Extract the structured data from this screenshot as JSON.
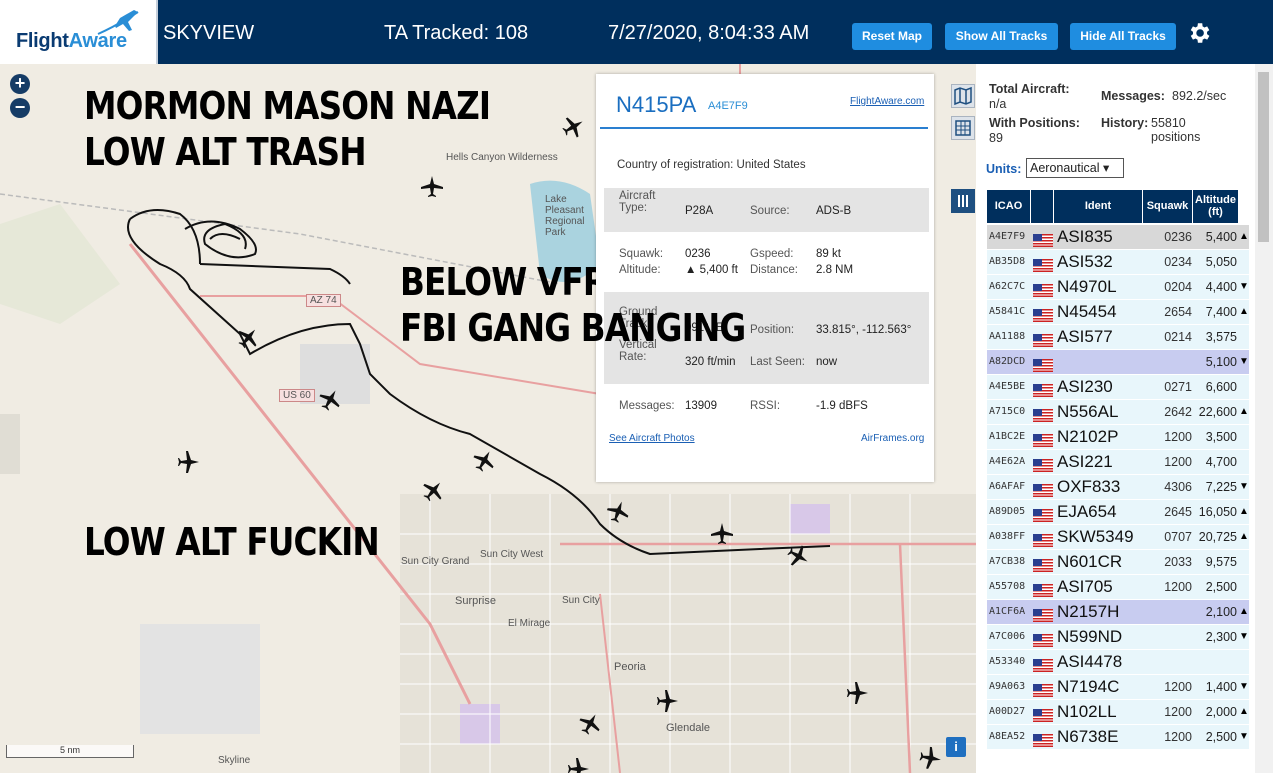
{
  "header": {
    "logo_text_1": "Flight",
    "logo_text_2": "Aware",
    "app_name": "SKYVIEW",
    "tracked": "TA Tracked: 108",
    "datetime": "7/27/2020, 8:04:33 AM",
    "reset_map": "Reset Map",
    "show_tracks": "Show All Tracks",
    "hide_tracks": "Hide All Tracks"
  },
  "overlay_text": {
    "line1": "MORMON MASON NAZI",
    "line2": "LOW ALT TRASH",
    "line3": "BELOW VFR",
    "line4": "FBI GANG BANGING",
    "line5": "LOW ALT FUCKIN"
  },
  "map": {
    "zoom_in": "+",
    "zoom_out": "−",
    "scale": "5 nm",
    "labels": {
      "hells_canyon": "Hells Canyon Wilderness",
      "lake": "Lake Pleasant Regional Park",
      "sun_city_west": "Sun City West",
      "sun_city_grand": "Sun City Grand",
      "surprise": "Surprise",
      "sun_city": "Sun City",
      "el_mirage": "El Mirage",
      "peoria": "Peoria",
      "glendale": "Glendale",
      "skyline": "Skyline",
      "az74": "AZ 74",
      "us60": "US 60"
    },
    "info": "i"
  },
  "popup": {
    "registration": "N415PA",
    "hex": "A4E7F9",
    "flightaware_link": "FlightAware.com",
    "country": "Country of registration: United States",
    "aircraft_type_label": "Aircraft Type:",
    "aircraft_type": "P28A",
    "source_label": "Source:",
    "source": "ADS-B",
    "squawk_label": "Squawk:",
    "squawk": "0236",
    "gspeed_label": "Gspeed:",
    "gspeed": "89 kt",
    "altitude_label": "Altitude:",
    "altitude": "▲ 5,400 ft",
    "distance_label": "Distance:",
    "distance": "2.8 NM",
    "ground_track_label": "Ground Track:",
    "ground_track": "091° (E)",
    "position_label": "Position:",
    "position": "33.815°, -112.563°",
    "vertical_rate_label": "Vertical Rate:",
    "vertical_rate": "320 ft/min",
    "last_seen_label": "Last Seen:",
    "last_seen": "now",
    "messages_label": "Messages:",
    "messages": "13909",
    "rssi_label": "RSSI:",
    "rssi": "-1.9 dBFS",
    "photos_link": "See Aircraft Photos",
    "airframes_link": "AirFrames.org"
  },
  "sidebar": {
    "total_aircraft_label": "Total Aircraft:",
    "total_aircraft": "n/a",
    "messages_label": "Messages:",
    "messages": "892.2/sec",
    "with_positions_label": "With Positions:",
    "with_positions": "89",
    "history_label": "History:",
    "history": "55810 positions",
    "units_label": "Units:",
    "units_value": "Aeronautical ▾",
    "columns": {
      "icao": "ICAO",
      "ident": "Ident",
      "squawk": "Squawk",
      "altitude": "Altitude (ft)"
    },
    "rows": [
      {
        "icao": "A4E7F9",
        "ident": "ASI835",
        "squawk": "0236",
        "alt": "5,400",
        "arrow": "▲",
        "sel": "g"
      },
      {
        "icao": "AB35D8",
        "ident": "ASI532",
        "squawk": "0234",
        "alt": "5,050",
        "arrow": "",
        "sel": ""
      },
      {
        "icao": "A62C7C",
        "ident": "N4970L",
        "squawk": "0204",
        "alt": "4,400",
        "arrow": "▼",
        "sel": ""
      },
      {
        "icao": "A5841C",
        "ident": "N45454",
        "squawk": "2654",
        "alt": "7,400",
        "arrow": "▲",
        "sel": ""
      },
      {
        "icao": "AA1188",
        "ident": "ASI577",
        "squawk": "0214",
        "alt": "3,575",
        "arrow": "",
        "sel": ""
      },
      {
        "icao": "A82DCD",
        "ident": "",
        "squawk": "",
        "alt": "5,100",
        "arrow": "▼",
        "sel": "p"
      },
      {
        "icao": "A4E5BE",
        "ident": "ASI230",
        "squawk": "0271",
        "alt": "6,600",
        "arrow": "",
        "sel": ""
      },
      {
        "icao": "A715C0",
        "ident": "N556AL",
        "squawk": "2642",
        "alt": "22,600",
        "arrow": "▲",
        "sel": ""
      },
      {
        "icao": "A1BC2E",
        "ident": "N2102P",
        "squawk": "1200",
        "alt": "3,500",
        "arrow": "",
        "sel": ""
      },
      {
        "icao": "A4E62A",
        "ident": "ASI221",
        "squawk": "1200",
        "alt": "4,700",
        "arrow": "",
        "sel": ""
      },
      {
        "icao": "A6AFAF",
        "ident": "OXF833",
        "squawk": "4306",
        "alt": "7,225",
        "arrow": "▼",
        "sel": ""
      },
      {
        "icao": "A89D05",
        "ident": "EJA654",
        "squawk": "2645",
        "alt": "16,050",
        "arrow": "▲",
        "sel": ""
      },
      {
        "icao": "A038FF",
        "ident": "SKW5349",
        "squawk": "0707",
        "alt": "20,725",
        "arrow": "▲",
        "sel": ""
      },
      {
        "icao": "A7CB38",
        "ident": "N601CR",
        "squawk": "2033",
        "alt": "9,575",
        "arrow": "",
        "sel": ""
      },
      {
        "icao": "A55708",
        "ident": "ASI705",
        "squawk": "1200",
        "alt": "2,500",
        "arrow": "",
        "sel": ""
      },
      {
        "icao": "A1CF6A",
        "ident": "N2157H",
        "squawk": "",
        "alt": "2,100",
        "arrow": "▲",
        "sel": "p"
      },
      {
        "icao": "A7C006",
        "ident": "N599ND",
        "squawk": "",
        "alt": "2,300",
        "arrow": "▼",
        "sel": ""
      },
      {
        "icao": "A53340",
        "ident": "ASI4478",
        "squawk": "",
        "alt": "",
        "arrow": "",
        "sel": ""
      },
      {
        "icao": "A9A063",
        "ident": "N7194C",
        "squawk": "1200",
        "alt": "1,400",
        "arrow": "▼",
        "sel": ""
      },
      {
        "icao": "A00D27",
        "ident": "N102LL",
        "squawk": "1200",
        "alt": "2,000",
        "arrow": "▲",
        "sel": ""
      },
      {
        "icao": "A8EA52",
        "ident": "N6738E",
        "squawk": "1200",
        "alt": "2,500",
        "arrow": "▼",
        "sel": ""
      }
    ]
  }
}
